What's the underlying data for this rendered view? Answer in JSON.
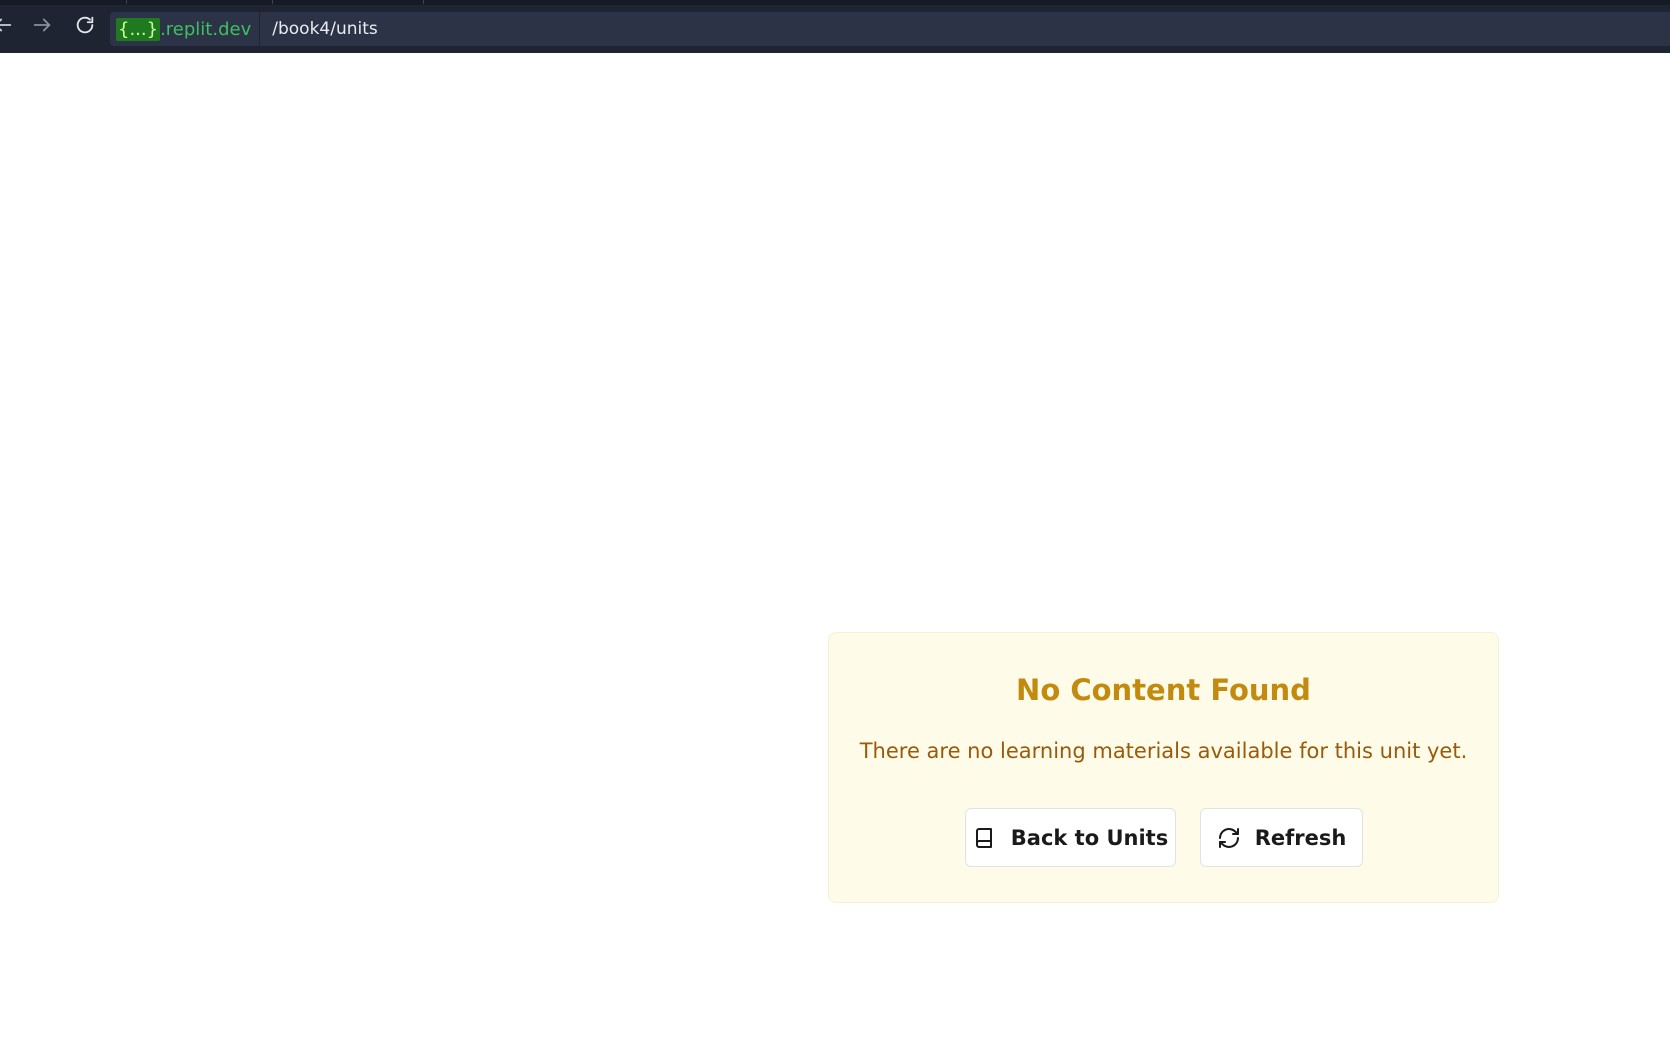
{
  "browser": {
    "url_host_braces": "{...}",
    "url_host_domain": ".replit.dev",
    "url_path": "/book4/units",
    "nav": {
      "back_icon": "arrow-left-icon",
      "forward_icon": "arrow-right-icon",
      "reload_icon": "reload-icon"
    }
  },
  "notice": {
    "title": "No Content Found",
    "message": "There are no learning materials available for this unit yet.",
    "back_button_label": "Back to Units",
    "back_button_icon": "book-icon",
    "refresh_button_label": "Refresh",
    "refresh_button_icon": "refresh-icon"
  },
  "colors": {
    "card_background": "#fefbe8",
    "title": "#c28a0e",
    "message": "#9a5a0a",
    "browser_bar": "#1f2433",
    "url_host": "#3fbf5f"
  }
}
